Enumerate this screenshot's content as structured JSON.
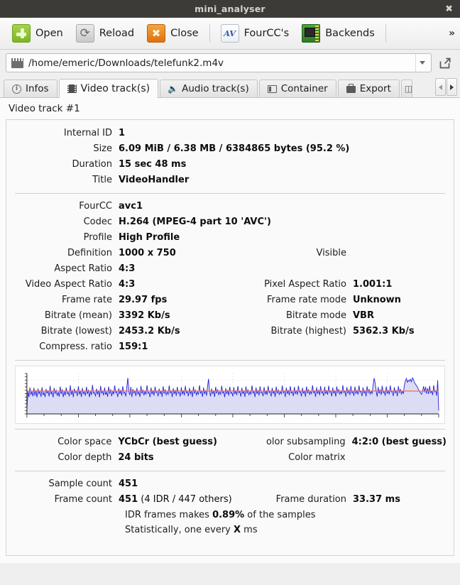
{
  "window": {
    "title": "mini_analyser",
    "close_label": "✖"
  },
  "toolbar": {
    "buttons": [
      {
        "label": "Open",
        "icon": "plus-icon"
      },
      {
        "label": "Reload",
        "icon": "refresh-icon"
      },
      {
        "label": "Close",
        "icon": "close-x-icon"
      },
      {
        "label": "FourCC's",
        "icon": "av-icon"
      },
      {
        "label": "Backends",
        "icon": "chip-icon"
      }
    ],
    "fourcc_icon_text": "AV",
    "overflow_label": "»"
  },
  "pathbar": {
    "icon": "film-icon",
    "value": "/home/emeric/Downloads/telefunk2.m4v",
    "dropdown_icon": "chevron-down-icon",
    "external_icon": "open-external-icon"
  },
  "tabs": [
    {
      "label": "Infos",
      "icon": "info-icon",
      "active": false
    },
    {
      "label": "Video track(s)",
      "icon": "video-icon",
      "active": true
    },
    {
      "label": "Audio track(s)",
      "icon": "audio-icon",
      "active": false
    },
    {
      "label": "Container",
      "icon": "container-icon",
      "active": false
    },
    {
      "label": "Export",
      "icon": "export-icon",
      "active": false
    }
  ],
  "tab_nav": {
    "left": "◀",
    "right": "▶"
  },
  "track": {
    "heading": "Video track #1",
    "section1": [
      {
        "key": "Internal ID",
        "value": "1"
      },
      {
        "key": "Size",
        "value": "6.09 MiB  /  6.38 MB  /  6384865 bytes (95.2 %)"
      },
      {
        "key": "Duration",
        "value": "15 sec 48 ms"
      },
      {
        "key": "Title",
        "value": "VideoHandler"
      }
    ],
    "section2": [
      {
        "key": "FourCC",
        "value": "avc1"
      },
      {
        "key": "Codec",
        "value": "H.264 (MPEG-4 part 10 'AVC')"
      },
      {
        "key": "Profile",
        "value": "High Profile"
      },
      {
        "key": "Definition",
        "value": "1000 x 750",
        "key2": "Visible",
        "value2": ""
      },
      {
        "key": "Aspect Ratio",
        "value": "4:3"
      },
      {
        "key": "Video Aspect Ratio",
        "value": "4:3",
        "key2": "Pixel Aspect Ratio",
        "value2": "1.001:1"
      },
      {
        "key": "Frame rate",
        "value": "29.97 fps",
        "key2": "Frame rate mode",
        "value2": "Unknown"
      },
      {
        "key": "Bitrate (mean)",
        "value": "3392 Kb/s",
        "key2": "Bitrate mode",
        "value2": "VBR"
      },
      {
        "key": "Bitrate (lowest)",
        "value": "2453.2 Kb/s",
        "key2": "Bitrate (highest)",
        "value2": "5362.3 Kb/s"
      },
      {
        "key": "Compress. ratio",
        "value": "159:1"
      }
    ],
    "section3": [
      {
        "key": "Color space",
        "value": "YCbCr (best guess)",
        "key2": "olor subsampling",
        "value2": "4:2:0 (best guess)"
      },
      {
        "key": "Color depth",
        "value": "24 bits",
        "key2": "Color matrix",
        "value2": ""
      }
    ],
    "section4": [
      {
        "key": "Sample count",
        "value": "451"
      },
      {
        "key": "Frame count",
        "value": "451",
        "value_suffix": " (4 IDR / 447 others)",
        "key2": "Frame duration",
        "value2": "33.37 ms"
      }
    ],
    "notes": [
      {
        "pre": "IDR frames makes ",
        "strong": "0.89%",
        "post": " of the samples"
      },
      {
        "pre": "Statistically, one every ",
        "strong": "X",
        "post": " ms"
      }
    ]
  },
  "chart_data": {
    "type": "line",
    "title": "",
    "xlabel": "",
    "ylabel": "",
    "ylim": [
      0,
      6000
    ],
    "xlim": [
      0,
      451
    ],
    "grid": true,
    "legend": false,
    "line_color": "#2222dd",
    "fill_color": "#dcdcf5",
    "mean_color": "#e8795a",
    "mean_value": 3392,
    "min_value": 2453.2,
    "max_value": 5362.3,
    "series": [
      {
        "name": "bitrate",
        "values": [
          520,
          3400,
          2500,
          3900,
          2900,
          3300,
          2600,
          3850,
          2700,
          3500,
          2450,
          3750,
          3000,
          3350,
          2550,
          3950,
          2800,
          3200,
          2500,
          3700,
          3100,
          3400,
          2600,
          4150,
          2900,
          3300,
          2450,
          3850,
          3050,
          3500,
          2700,
          3250,
          2550,
          4050,
          2950,
          3650,
          2500,
          3350,
          2750,
          3900,
          3000,
          3200,
          2600,
          4250,
          2850,
          3550,
          2480,
          3750,
          3150,
          3300,
          2650,
          4100,
          2900,
          3450,
          2520,
          3850,
          3000,
          3250,
          2700,
          4000,
          2950,
          3600,
          2500,
          3400,
          2800,
          4300,
          3050,
          3200,
          2600,
          3750,
          2900,
          3500,
          2460,
          4150,
          3100,
          3350,
          2750,
          3900,
          2850,
          3250,
          2550,
          4050,
          3000,
          3650,
          2620,
          3400,
          2900,
          4200,
          3150,
          3300,
          2500,
          3800,
          2950,
          3550,
          2700,
          4100,
          3050,
          3200,
          2600,
          3950,
          5350,
          3300,
          2800,
          4000,
          2500,
          3700,
          3100,
          3400,
          2650,
          3850,
          2950,
          3250,
          2520,
          4150,
          3000,
          3600,
          2750,
          3350,
          2880,
          4250,
          3050,
          3200,
          2480,
          3900,
          2900,
          3500,
          2700,
          4050,
          3150,
          3300,
          2600,
          3750,
          2950,
          3450,
          2540,
          4100,
          3000,
          3650,
          2820,
          3250,
          2900,
          4200,
          3100,
          3350,
          2500,
          3800,
          2960,
          3550,
          2680,
          4000,
          3050,
          3200,
          2580,
          3950,
          2900,
          3500,
          2740,
          4150,
          3120,
          3300,
          2620,
          3850,
          2980,
          3400,
          2500,
          4050,
          3000,
          3600,
          2800,
          3250,
          2920,
          4250,
          3080,
          3350,
          2540,
          3900,
          2940,
          3520,
          2700,
          4100,
          5200,
          3300,
          2600,
          3750,
          2980,
          3450,
          2520,
          4000,
          3040,
          3650,
          2860,
          3250,
          2900,
          4180,
          3100,
          3300,
          2480,
          3820,
          2960,
          3550,
          2720,
          4020,
          3060,
          3200,
          2600,
          3960,
          2920,
          3480,
          2780,
          4120,
          3140,
          3320,
          2560,
          3880,
          2980,
          3420,
          2520,
          4060,
          3020,
          3620,
          2840,
          3260,
          2940,
          4220,
          3080,
          3340,
          2500,
          3920,
          2960,
          3540,
          2740,
          4080,
          3100,
          3220,
          2620,
          3980,
          2900,
          3460,
          2800,
          4140,
          3160,
          3310,
          2580,
          3860,
          3000,
          3440,
          2540,
          4040,
          3040,
          3600,
          2880,
          3280,
          2960,
          4200,
          3120,
          3360,
          2520,
          3900,
          2980,
          3560,
          2760,
          4100,
          3080,
          3240,
          2640,
          4000,
          2940,
          3500,
          2820,
          4160,
          3180,
          3330,
          2600,
          3880,
          3020,
          3460,
          2560,
          4060,
          3060,
          3640,
          2900,
          3300,
          2980,
          4240,
          3140,
          3380,
          2540,
          3940,
          3000,
          3580,
          2780,
          4120,
          3100,
          3260,
          2660,
          4020,
          2960,
          3520,
          2840,
          4180,
          3200,
          3350,
          2620,
          3900,
          3040,
          3480,
          2580,
          4080,
          3080,
          3660,
          2920,
          3320,
          3000,
          4260,
          3160,
          3400,
          2560,
          3960,
          3020,
          3600,
          2800,
          4140,
          3120,
          3280,
          2680,
          4040,
          2980,
          3540,
          2860,
          4200,
          3220,
          3370,
          2640,
          3920,
          3060,
          3500,
          2600,
          4100,
          3100,
          3680,
          2940,
          3340,
          3020,
          4280,
          5300,
          4600,
          3420,
          2580,
          3980,
          3040,
          3620,
          2820,
          4160,
          3140,
          3300,
          2700,
          4060,
          3000,
          3560,
          2880,
          4220,
          3240,
          3390,
          2660,
          3940,
          3080,
          3520,
          2620,
          4120,
          3120,
          3700,
          2960,
          3360,
          3040,
          4300,
          4900,
          5250,
          4700,
          5000,
          4850,
          5150,
          4750,
          5350,
          5100,
          4600,
          4400,
          4200,
          3900,
          3600,
          3300,
          3100,
          2900,
          3400,
          4100,
          3200,
          4000,
          3000,
          3800,
          2950,
          4150,
          3150,
          3350,
          2800,
          4250,
          3250,
          3450,
          2700,
          5000,
          480
        ]
      }
    ]
  }
}
